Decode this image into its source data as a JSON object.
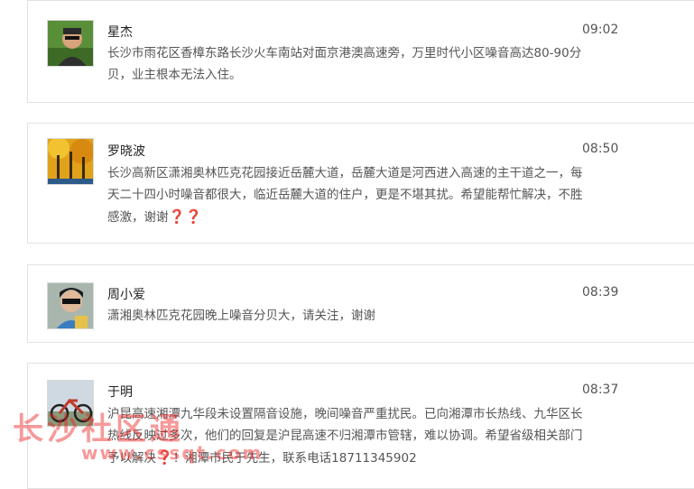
{
  "comments": [
    {
      "name": "星杰",
      "time": "09:02",
      "text": "长沙市雨花区香樟东路长沙火车南站对面京港澳高速旁，万里时代小区噪音高达80-90分贝，业主根本无法入住。",
      "question_marks": ""
    },
    {
      "name": "罗晓波",
      "time": "08:50",
      "text": "长沙高新区潇湘奥林匹克花园接近岳麓大道，岳麓大道是河西进入高速的主干道之一，每天二十四小时噪音都很大，临近岳麓大道的住户，更是不堪其扰。希望能帮忙解决，不胜感激，谢谢",
      "question_marks": "❓❓"
    },
    {
      "name": "周小爱",
      "time": "08:39",
      "text": "潇湘奥林匹克花园晚上噪音分贝大，请关注，谢谢",
      "question_marks": ""
    },
    {
      "name": "于明",
      "time": "08:37",
      "text": "沪昆高速湘潭九华段未设置隔音设施，晚间噪音严重扰民。已向湘潭市长热线、九华区长热线反映过多次，他们的回复是沪昆高速不归湘潭市管辖，难以协调。希望省级相关部门予以解决",
      "question_marks": "❓",
      "text_after": "！湘潭市民于先生，联系电话18711345902"
    }
  ],
  "watermark": {
    "main": "长沙社区通",
    "url": "www.cssqt.com"
  }
}
